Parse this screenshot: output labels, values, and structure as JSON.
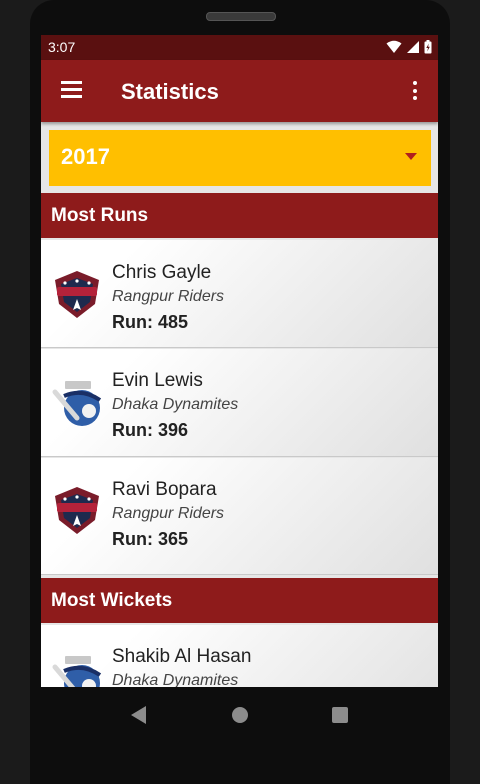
{
  "status_bar": {
    "time": "3:07"
  },
  "app_bar": {
    "title": "Statistics"
  },
  "year_selector": {
    "selected": "2017"
  },
  "sections": {
    "most_runs": {
      "label": "Most Runs",
      "items": [
        {
          "name": "Chris Gayle",
          "team": "Rangpur Riders",
          "stat": "Run: 485",
          "logo": "rangpur-riders-logo"
        },
        {
          "name": "Evin Lewis",
          "team": "Dhaka Dynamites",
          "stat": "Run: 396",
          "logo": "dhaka-dynamites-logo"
        },
        {
          "name": "Ravi Bopara",
          "team": "Rangpur Riders",
          "stat": "Run: 365",
          "logo": "rangpur-riders-logo"
        }
      ]
    },
    "most_wickets": {
      "label": "Most Wickets",
      "items": [
        {
          "name": "Shakib Al Hasan",
          "team": "Dhaka Dynamites",
          "logo": "dhaka-dynamites-logo"
        }
      ]
    }
  },
  "colors": {
    "primary": "#8e1b1b",
    "status_bar": "#5a1010",
    "accent": "#ffbf00",
    "caret": "#b01f1f"
  },
  "icons": [
    "hamburger-menu-icon",
    "more-vert-icon",
    "dropdown-caret-icon",
    "wifi-icon",
    "signal-icon",
    "battery-icon",
    "back-icon",
    "home-icon",
    "recents-icon"
  ]
}
